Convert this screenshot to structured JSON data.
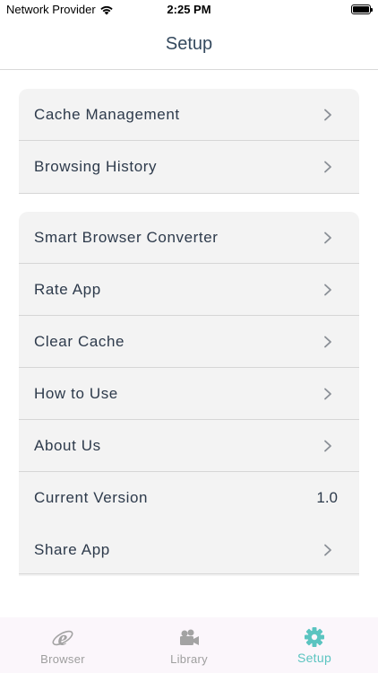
{
  "status_bar": {
    "carrier": "Network Provider",
    "time": "2:25 PM"
  },
  "nav": {
    "title": "Setup"
  },
  "group1": [
    {
      "label": "Cache Management"
    },
    {
      "label": "Browsing History"
    }
  ],
  "group2": [
    {
      "label": "Smart Browser Converter"
    },
    {
      "label": "Rate App"
    },
    {
      "label": "Clear Cache"
    },
    {
      "label": "How to Use"
    },
    {
      "label": "About Us"
    },
    {
      "label": "Current Version",
      "value": "1.0"
    },
    {
      "label": "Share App"
    }
  ],
  "tabs": [
    {
      "label": "Browser",
      "icon": "internet-explorer-icon"
    },
    {
      "label": "Library",
      "icon": "video-camera-icon"
    },
    {
      "label": "Setup",
      "icon": "gear-icon",
      "active": true
    }
  ],
  "colors": {
    "accent": "#5bc4c0",
    "group_bg": "#f3f3f3",
    "tab_bar_bg": "#fbf6fb"
  }
}
